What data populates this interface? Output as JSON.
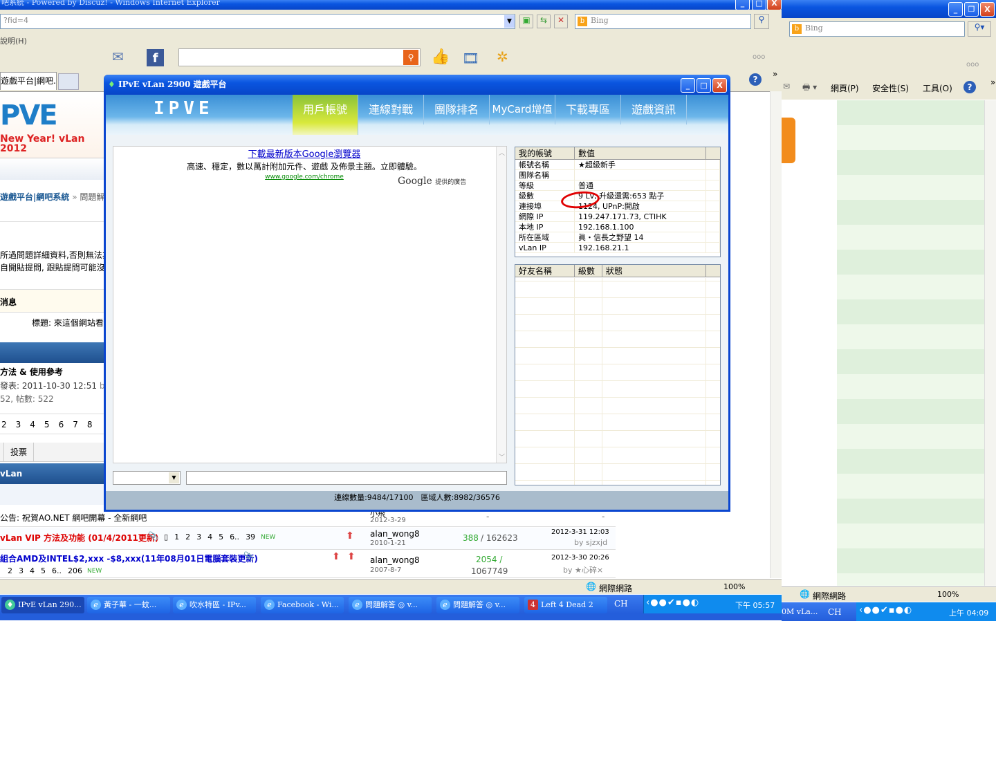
{
  "back_ie": {
    "title": "吧系統 - Powered by Discuz! - Windows Internet Explorer",
    "address": "?fid=4",
    "search_placeholder": "Bing",
    "menu_help": "說明(H)",
    "tab_label": "遊戲平台|網吧...",
    "more": "ooo",
    "status_zone": "網際網路",
    "zoom": "100%"
  },
  "page": {
    "banner_text": "New Year! vLan 2012",
    "breadcrumb_link": "遊戲平台|網吧系統",
    "breadcrumb_sep": "»",
    "breadcrumb_current": "問題解",
    "notice_1": "所過問題詳細資料,否則無法為",
    "notice_2": "自開貼提問, 跟貼提問可能沒人",
    "messages_heading": "消息",
    "message_title": "標題: 來這個網站看看",
    "sticky_title": "方法 & 使用參考",
    "sticky_date": "發表: 2011-10-30 12:51",
    "sticky_by": "by",
    "sticky_stats": "52, 帖數: 522",
    "pages": [
      "2",
      "3",
      "4",
      "5",
      "6",
      "7",
      "8"
    ],
    "vote_tab": "投票",
    "section_title": "vLan",
    "threads": [
      {
        "title": "公告: 祝賀AO.NET 網吧開幕 - 全新網吧",
        "author": "小飛",
        "date": "2012-3-29",
        "replies": "-",
        "last": "-",
        "color": "#000000"
      },
      {
        "title": "vLan VIP 方法及功能 (01/4/2011更新)",
        "pages": [
          "1",
          "2",
          "3",
          "4",
          "5",
          "6.."
        ],
        "last_page": "39",
        "new": "NEW",
        "author": "alan_wong8",
        "date": "2010-1-21",
        "replies": "388",
        "views": "/ 162623",
        "last_date": "2012-3-31 12:03",
        "last_by": "by sjzxjd",
        "color": "#dd0000"
      },
      {
        "title": "組合AMD及INTEL$2,xxx -$8,xxx(11年08月01日電腦套裝更新)",
        "pages": [
          "2",
          "3",
          "4",
          "5",
          "6.."
        ],
        "last_page": "206",
        "new": "NEW",
        "author": "alan_wong8",
        "date": "2007-8-7",
        "replies": "2054 /",
        "views": "1067749",
        "last_date": "2012-3-30 20:26",
        "last_by": "by ★心碎×",
        "color": "#0000cc"
      }
    ]
  },
  "dialog": {
    "title": "IPvE vLan 2900 遊戲平台",
    "logo": "IPVE",
    "nav": [
      "用戶帳號",
      "連線對戰",
      "團隊排名",
      "MyCard增值",
      "下載專區",
      "遊戲資訊"
    ],
    "active_nav": 0,
    "ad": {
      "headline": "下載最新版本Google瀏覽器",
      "body": "高速、穩定，數以萬計附加元件、遊戲 及佈景主題。立即體驗。",
      "url": "www.google.com/chrome",
      "google": "Google",
      "provided": "提供的廣告"
    },
    "account_table": {
      "headers": [
        "我的帳號",
        "數值"
      ],
      "rows": [
        [
          "帳號名稱",
          "★超級新手"
        ],
        [
          "團隊名稱",
          ""
        ],
        [
          "等級",
          "普通"
        ],
        [
          "級數",
          "9 Lv, 升級還需:653 點子"
        ],
        [
          "連接埠",
          "1124, UPnP:開啟"
        ],
        [
          "網際 IP",
          "119.247.171.73, CTIHK"
        ],
        [
          "本地 IP",
          "192.168.1.100"
        ],
        [
          "所在區域",
          "眞・信長之野望 14"
        ],
        [
          "vLan IP",
          "192.168.21.1"
        ]
      ]
    },
    "friends_table": {
      "headers": [
        "好友名稱",
        "級數",
        "狀態"
      ]
    },
    "status": "連線數量:9484/17100　區域人數:8982/36576",
    "annotation_color": "#e00000"
  },
  "front_ie": {
    "search_placeholder": "Bing",
    "more": "ooo",
    "toolbar": [
      "網頁(P)",
      "安全性(S)",
      "工具(O)"
    ],
    "status_zone": "網際網路",
    "zoom": "100%"
  },
  "taskbar": {
    "buttons": [
      "IPvE vLan 290...",
      "黃子華 - 一蚊...",
      "吹水特區 - IPv...",
      "Facebook - Wi...",
      "問題解答 ◎ v...",
      "問題解答 ◎ v...",
      "Left 4 Dead 2"
    ],
    "lang": "CH",
    "clock": "下午 05:57",
    "second_lang": "CH",
    "second_clock": "上午 04:09",
    "second_partial": "0M vLa..."
  }
}
